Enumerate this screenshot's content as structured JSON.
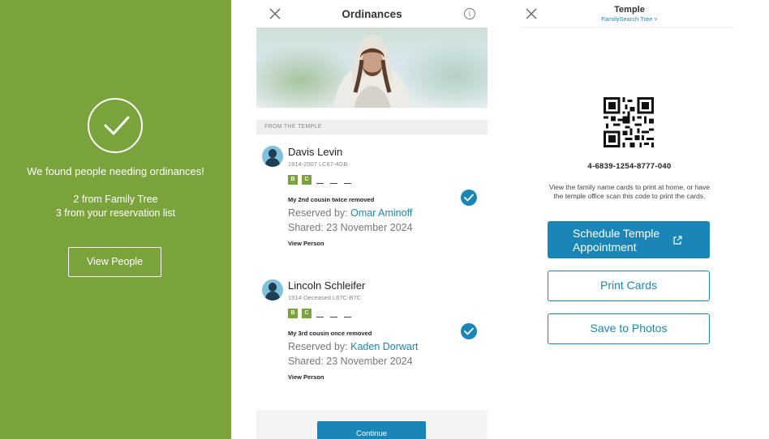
{
  "green_panel": {
    "found_text": "We found people needing ordinances!",
    "family_tree_count": "2  from Family Tree",
    "reservation_count": "3  from your reservation list",
    "view_people_label": "View People"
  },
  "ordinances_panel": {
    "title": "Ordinances",
    "info_glyph": "i",
    "section_label": "FROM THE TEMPLE",
    "people": [
      {
        "name": "Davis Levin",
        "meta": "1914-2007   LC67-4GB",
        "ordinances": [
          "B",
          "C"
        ],
        "relation": "My 2nd cousin twice removed",
        "reserved_prefix": "Reserved by: ",
        "reserved_by": "Omar Aminoff",
        "shared": "Shared: 23 November 2024",
        "view_person": "View Person"
      },
      {
        "name": "Lincoln Schleifer",
        "meta": "1914-Deceased   L67C-B7C",
        "ordinances": [
          "B",
          "C"
        ],
        "relation": "My 3rd cousin once removed",
        "reserved_prefix": "Reserved by: ",
        "reserved_by": "Kaden Dorwart",
        "shared": "Shared: 23 November 2024",
        "view_person": "View Person"
      }
    ],
    "continue_label": "Continue"
  },
  "temple_panel": {
    "title": "Temple",
    "subtitle": "FamilySearch Tree ˅",
    "code": "4-6839-1254-8777-040",
    "description": "View the family name cards to print at home, or have the temple office scan this code to print the cards.",
    "schedule_label": "Schedule Temple Appointment",
    "print_label": "Print Cards",
    "save_label": "Save to Photos"
  },
  "colors": {
    "green": "#7aa43b",
    "accent_blue": "#1a86b8"
  },
  "icons": [
    "checkmark-icon",
    "close-icon",
    "info-icon",
    "avatar-icon",
    "external-link-icon",
    "qr-code-icon"
  ]
}
